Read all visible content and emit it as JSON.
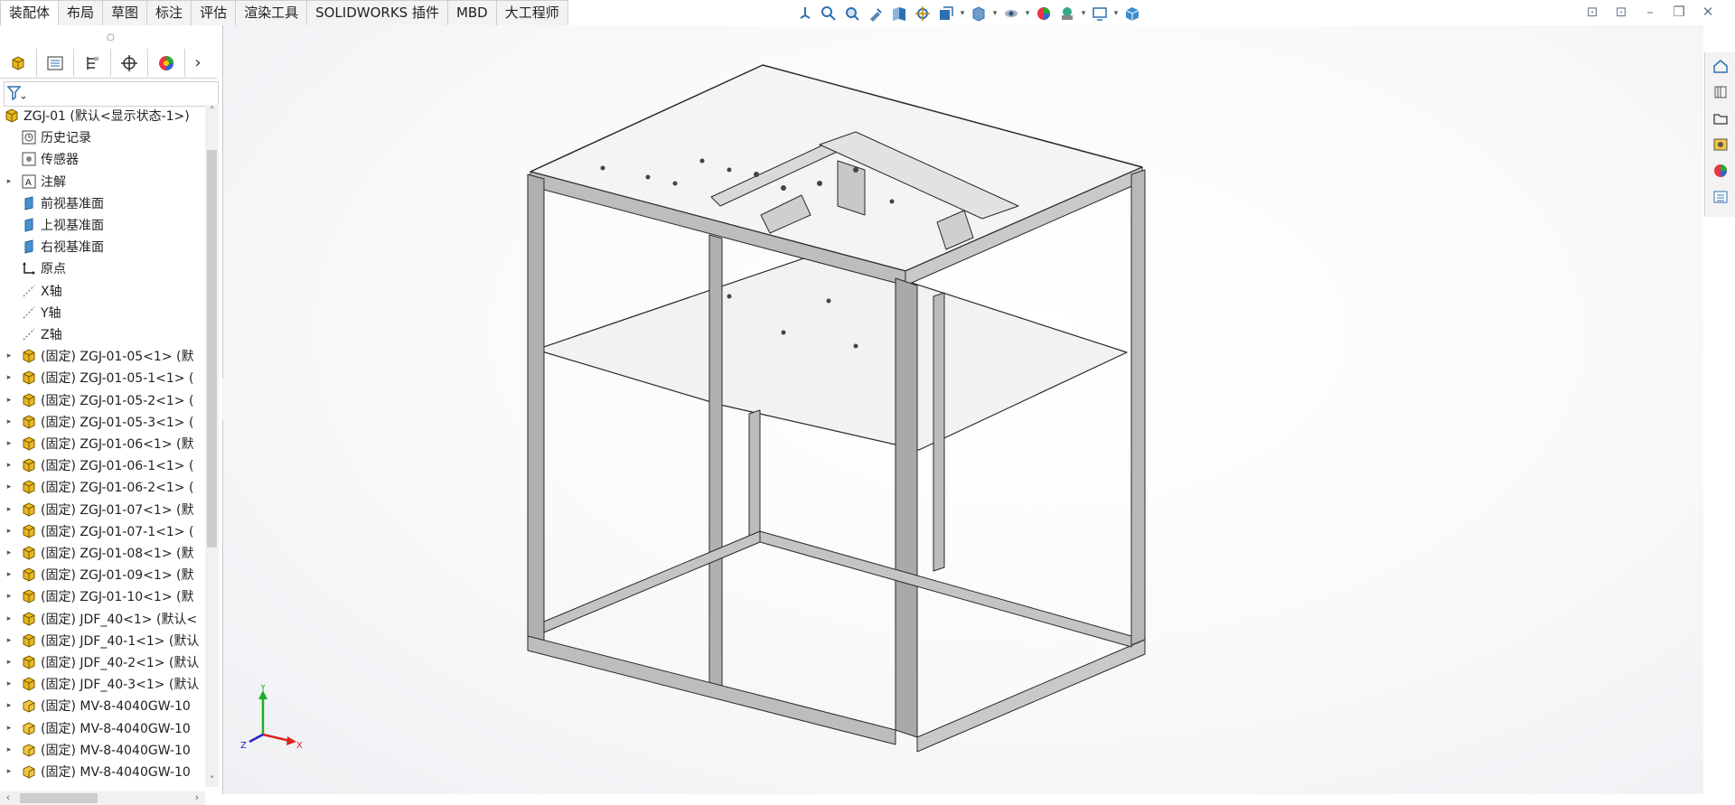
{
  "command_tabs": [
    "装配体",
    "布局",
    "草图",
    "标注",
    "评估",
    "渲染工具",
    "SOLIDWORKS 插件",
    "MBD",
    "大工程师"
  ],
  "heads_up_toolbar": [
    "view-orientation-icon",
    "zoom-to-fit-icon",
    "zoom-to-area-icon",
    "previous-view-icon",
    "section-view-icon",
    "dynamic-annotation-icon",
    "view-orientation-dropdown-icon",
    "display-style-icon",
    "hide-show-items-icon",
    "edit-appearance-icon",
    "apply-scene-icon",
    "view-settings-icon",
    "3d-view-icon"
  ],
  "window_controls": [
    "tile-left-icon",
    "tile-right-icon",
    "restore-icon",
    "minimize-icon",
    "maximize-icon"
  ],
  "panel_tabs": [
    "featuremanager-icon",
    "propertymanager-icon",
    "configurationmanager-icon",
    "dimxpert-icon",
    "display-manager-icon"
  ],
  "tree": {
    "root": "ZGJ-01  (默认<显示状态-1>)",
    "items": [
      {
        "label": "历史记录",
        "icon": "history-icon",
        "expandable": false
      },
      {
        "label": "传感器",
        "icon": "sensor-icon",
        "expandable": false
      },
      {
        "label": "注解",
        "icon": "annotation-icon",
        "expandable": true
      },
      {
        "label": "前视基准面",
        "icon": "plane-icon",
        "expandable": false
      },
      {
        "label": "上视基准面",
        "icon": "plane-icon",
        "expandable": false
      },
      {
        "label": "右视基准面",
        "icon": "plane-icon",
        "expandable": false
      },
      {
        "label": "原点",
        "icon": "origin-icon",
        "expandable": false
      },
      {
        "label": "X轴",
        "icon": "axis-icon",
        "expandable": false
      },
      {
        "label": "Y轴",
        "icon": "axis-icon",
        "expandable": false
      },
      {
        "label": "Z轴",
        "icon": "axis-icon",
        "expandable": false
      },
      {
        "label": "(固定) ZGJ-01-05<1> (默",
        "icon": "subassembly-icon",
        "expandable": true
      },
      {
        "label": "(固定) ZGJ-01-05-1<1> (",
        "icon": "subassembly-icon",
        "expandable": true
      },
      {
        "label": "(固定) ZGJ-01-05-2<1> (",
        "icon": "subassembly-icon",
        "expandable": true
      },
      {
        "label": "(固定) ZGJ-01-05-3<1> (",
        "icon": "subassembly-icon",
        "expandable": true
      },
      {
        "label": "(固定) ZGJ-01-06<1> (默",
        "icon": "subassembly-icon",
        "expandable": true
      },
      {
        "label": "(固定) ZGJ-01-06-1<1> (",
        "icon": "subassembly-icon",
        "expandable": true
      },
      {
        "label": "(固定) ZGJ-01-06-2<1> (",
        "icon": "subassembly-icon",
        "expandable": true
      },
      {
        "label": "(固定) ZGJ-01-07<1> (默",
        "icon": "subassembly-icon",
        "expandable": true
      },
      {
        "label": "(固定) ZGJ-01-07-1<1> (",
        "icon": "subassembly-icon",
        "expandable": true
      },
      {
        "label": "(固定) ZGJ-01-08<1> (默",
        "icon": "subassembly-icon",
        "expandable": true
      },
      {
        "label": "(固定) ZGJ-01-09<1> (默",
        "icon": "subassembly-icon",
        "expandable": true
      },
      {
        "label": "(固定) ZGJ-01-10<1> (默",
        "icon": "subassembly-icon",
        "expandable": true
      },
      {
        "label": "(固定) JDF_40<1> (默认<",
        "icon": "subassembly-icon",
        "expandable": true
      },
      {
        "label": "(固定) JDF_40-1<1> (默认",
        "icon": "subassembly-icon",
        "expandable": true
      },
      {
        "label": "(固定) JDF_40-2<1> (默认",
        "icon": "subassembly-icon",
        "expandable": true
      },
      {
        "label": "(固定) JDF_40-3<1> (默认",
        "icon": "subassembly-icon",
        "expandable": true
      },
      {
        "label": "(固定) MV-8-4040GW-10",
        "icon": "part-icon",
        "expandable": true
      },
      {
        "label": "(固定) MV-8-4040GW-10",
        "icon": "part-icon",
        "expandable": true
      },
      {
        "label": "(固定) MV-8-4040GW-10",
        "icon": "part-icon",
        "expandable": true
      },
      {
        "label": "(固定) MV-8-4040GW-10",
        "icon": "part-icon",
        "expandable": true
      }
    ]
  },
  "task_pane": [
    "home-icon",
    "3d-library-icon",
    "file-explorer-icon",
    "view-palette-icon",
    "appearances-icon",
    "custom-properties-icon"
  ],
  "triad": {
    "x": "X",
    "y": "Y",
    "z": "Z"
  },
  "colors": {
    "accent": "#1f6fb5",
    "tree_icon_yellow": "#e8b820",
    "axis_x": "#d22",
    "axis_y": "#2a2",
    "axis_z": "#22c"
  }
}
